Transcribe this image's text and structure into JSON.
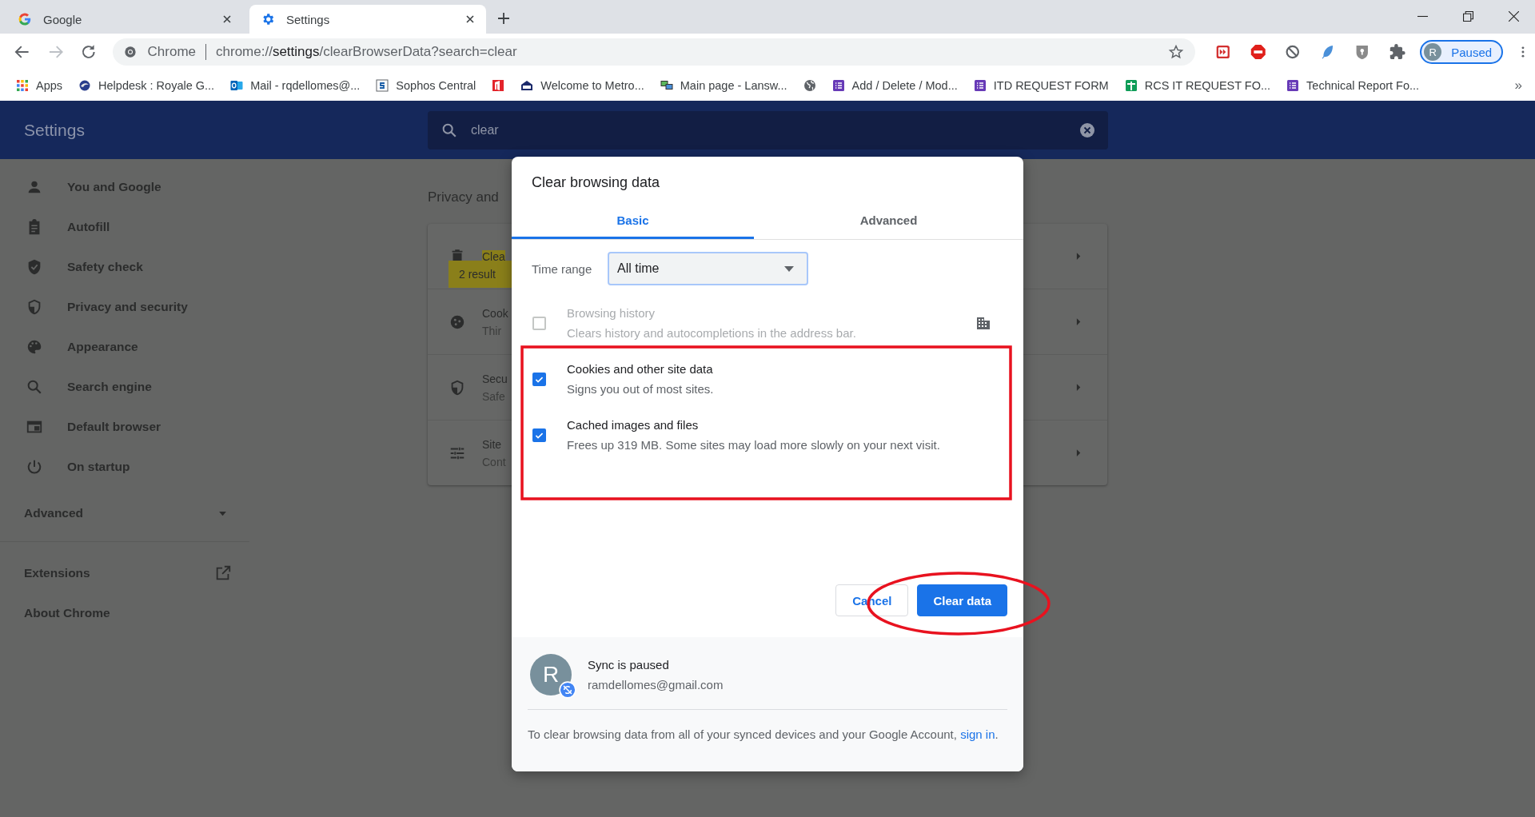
{
  "browser": {
    "tabs": [
      {
        "title": "Google",
        "kind": "google",
        "selected": false
      },
      {
        "title": "Settings",
        "kind": "gear",
        "selected": true
      }
    ],
    "address": {
      "site_label": "Chrome",
      "url_prefix": "chrome://",
      "url_host": "settings",
      "url_suffix": "/clearBrowserData?search=clear",
      "bookmarked": false
    },
    "extensions": [
      {
        "kind": "forward-box"
      },
      {
        "kind": "abp"
      },
      {
        "kind": "block"
      },
      {
        "kind": "feather"
      },
      {
        "kind": "lock"
      },
      {
        "kind": "puzzle"
      }
    ],
    "profile": {
      "initial": "R",
      "status": "Paused"
    },
    "bookmarks": [
      {
        "kind": "apps",
        "label": "Apps"
      },
      {
        "kind": "helpdesk",
        "label": "Helpdesk : Royale G..."
      },
      {
        "kind": "mail",
        "label": "Mail - rqdellomes@..."
      },
      {
        "kind": "sophos",
        "label": "Sophos Central"
      },
      {
        "kind": "office"
      },
      {
        "kind": "metro",
        "label": "Welcome to Metro..."
      },
      {
        "kind": "monitor",
        "label": "Main page - Lansw..."
      },
      {
        "kind": "globe"
      },
      {
        "kind": "form",
        "label": "Add / Delete / Mod..."
      },
      {
        "kind": "form",
        "label": "ITD REQUEST FORM"
      },
      {
        "kind": "sheet",
        "label": "RCS IT REQUEST FO..."
      },
      {
        "kind": "form",
        "label": "Technical Report Fo..."
      }
    ],
    "bookmarks_more": "»"
  },
  "settings": {
    "title": "Settings",
    "search": {
      "value": "clear"
    },
    "sidebar": {
      "items": [
        {
          "kind": "person",
          "label": "You and Google"
        },
        {
          "kind": "clipboard",
          "label": "Autofill"
        },
        {
          "kind": "shield-check",
          "label": "Safety check"
        },
        {
          "kind": "shield-half",
          "label": "Privacy and security"
        },
        {
          "kind": "palette",
          "label": "Appearance"
        },
        {
          "kind": "search",
          "label": "Search engine"
        },
        {
          "kind": "browser",
          "label": "Default browser"
        },
        {
          "kind": "power",
          "label": "On startup"
        }
      ],
      "advanced": {
        "label": "Advanced",
        "expanded": false
      },
      "links": [
        {
          "label": "Extensions",
          "external": true
        },
        {
          "label": "About Chrome",
          "external": false
        }
      ]
    },
    "section": {
      "heading": "Privacy and",
      "tooltip": "2 result",
      "rows": [
        {
          "kind": "trash",
          "title": "Clea",
          "match": true
        },
        {
          "kind": "cookie",
          "title": "Cook",
          "subtitle": "Thir",
          "match": false
        },
        {
          "kind": "shield-half",
          "title": "Secu",
          "subtitle": "Safe",
          "match": false
        },
        {
          "kind": "sliders",
          "title": "Site",
          "subtitle": "Cont",
          "match": false
        }
      ]
    }
  },
  "dialog": {
    "title": "Clear browsing data",
    "tabs": [
      {
        "label": "Basic",
        "selected": true
      },
      {
        "label": "Advanced",
        "selected": false
      }
    ],
    "time_range": {
      "label": "Time range",
      "value": "All time"
    },
    "options": [
      {
        "title": "Browsing history",
        "description": "Clears history and autocompletions in the address bar.",
        "checked": false,
        "disabled": true,
        "managed": true
      },
      {
        "title": "Cookies and other site data",
        "description": "Signs you out of most sites.",
        "checked": true,
        "disabled": false,
        "managed": false
      },
      {
        "title": "Cached images and files",
        "description": "Frees up 319 MB. Some sites may load more slowly on your next visit.",
        "checked": true,
        "disabled": false,
        "managed": false
      }
    ],
    "buttons": [
      {
        "label": "Cancel",
        "kind": "secondary"
      },
      {
        "label": "Clear data",
        "kind": "primary"
      }
    ],
    "sync": {
      "initial": "R",
      "status": "Sync is paused",
      "email": "ramdellomes@gmail.com"
    },
    "footer": {
      "text": "To clear browsing data from all of your synced devices and your Google Account,",
      "link": "sign in",
      "end": "."
    }
  }
}
